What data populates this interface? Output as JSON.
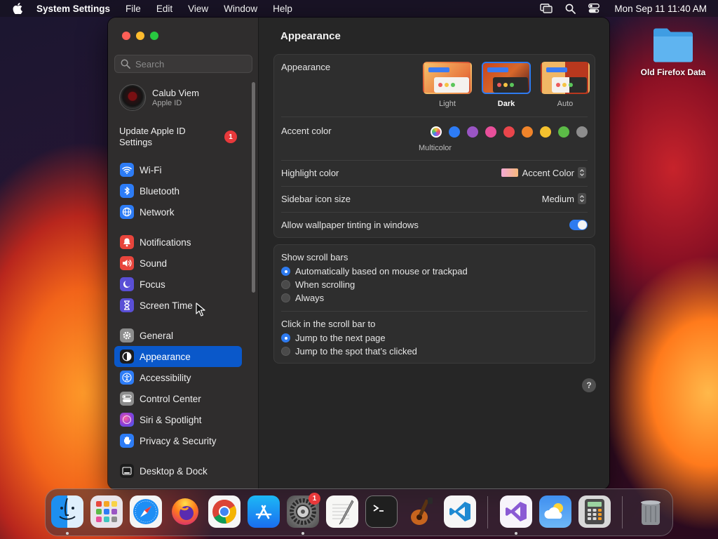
{
  "menubar": {
    "app_name": "System Settings",
    "items": [
      "File",
      "Edit",
      "View",
      "Window",
      "Help"
    ],
    "clock": "Mon Sep 11  11:40 AM",
    "icons": [
      "apple-icon",
      "screen-mirroring-icon",
      "spotlight-search-icon",
      "control-center-icon"
    ]
  },
  "sidebar": {
    "search_placeholder": "Search",
    "profile": {
      "name": "Calub Viem",
      "subtitle": "Apple ID"
    },
    "update": {
      "label": "Update Apple ID Settings",
      "badge": "1"
    },
    "items": [
      {
        "label": "Wi-Fi",
        "icon": "wifi-icon",
        "color": "#2d7cf6"
      },
      {
        "label": "Bluetooth",
        "icon": "bluetooth-icon",
        "color": "#2d7cf6"
      },
      {
        "label": "Network",
        "icon": "globe-icon",
        "color": "#2d7cf6"
      },
      {
        "label": "Notifications",
        "icon": "bell-icon",
        "color": "#e8453c"
      },
      {
        "label": "Sound",
        "icon": "speaker-icon",
        "color": "#e8453c"
      },
      {
        "label": "Focus",
        "icon": "moon-icon",
        "color": "#5a4fd6"
      },
      {
        "label": "Screen Time",
        "icon": "hourglass-icon",
        "color": "#5a4fd6"
      },
      {
        "label": "General",
        "icon": "gear-icon",
        "color": "#8c8c8c"
      },
      {
        "label": "Appearance",
        "icon": "appearance-icon",
        "color": "#1c1c1c",
        "selected": true
      },
      {
        "label": "Accessibility",
        "icon": "accessibility-icon",
        "color": "#2d7cf6"
      },
      {
        "label": "Control Center",
        "icon": "control-center-icon",
        "color": "#8c8c8c"
      },
      {
        "label": "Siri & Spotlight",
        "icon": "siri-icon",
        "color": "#b53fd1"
      },
      {
        "label": "Privacy & Security",
        "icon": "hand-icon",
        "color": "#2d7cf6"
      },
      {
        "label": "Desktop & Dock",
        "icon": "dock-icon",
        "color": "#1c1c1c"
      }
    ]
  },
  "main": {
    "title": "Appearance",
    "appearance": {
      "label": "Appearance",
      "options": [
        "Light",
        "Dark",
        "Auto"
      ],
      "selected": "Dark"
    },
    "accent": {
      "label": "Accent color",
      "caption": "Multicolor",
      "colors": [
        "multicolor",
        "#2d7cf6",
        "#9a55c4",
        "#e84f9a",
        "#e9454b",
        "#f0842a",
        "#f5c12e",
        "#5cbb47",
        "#8d8d8d"
      ]
    },
    "highlight": {
      "label": "Highlight color",
      "value": "Accent Color"
    },
    "sidebar_icon_size": {
      "label": "Sidebar icon size",
      "value": "Medium"
    },
    "wallpaper_tinting": {
      "label": "Allow wallpaper tinting in windows",
      "enabled": true
    },
    "scroll_bars": {
      "label": "Show scroll bars",
      "options": [
        "Automatically based on mouse or trackpad",
        "When scrolling",
        "Always"
      ],
      "selected": "Automatically based on mouse or trackpad"
    },
    "click_scroll": {
      "label": "Click in the scroll bar to",
      "options": [
        "Jump to the next page",
        "Jump to the spot that’s clicked"
      ],
      "selected": "Jump to the next page"
    },
    "help": "?"
  },
  "desktop": {
    "folder_label": "Old Firefox Data"
  },
  "dock": {
    "apps": [
      {
        "name": "Finder",
        "icon": "finder-icon",
        "running": true
      },
      {
        "name": "Launchpad",
        "icon": "launchpad-icon"
      },
      {
        "name": "Safari",
        "icon": "safari-icon"
      },
      {
        "name": "Firefox",
        "icon": "firefox-icon"
      },
      {
        "name": "Chrome",
        "icon": "chrome-icon"
      },
      {
        "name": "App Store",
        "icon": "app-store-icon"
      },
      {
        "name": "System Settings",
        "icon": "system-settings-icon",
        "running": true,
        "badge": "1"
      },
      {
        "name": "TextEdit",
        "icon": "textedit-icon"
      },
      {
        "name": "Terminal",
        "icon": "terminal-icon"
      },
      {
        "name": "GarageBand",
        "icon": "garageband-icon"
      },
      {
        "name": "Visual Studio Code",
        "icon": "vscode-icon"
      },
      {
        "name": "Visual Studio",
        "icon": "visual-studio-icon",
        "running": true
      },
      {
        "name": "Weather",
        "icon": "weather-icon"
      },
      {
        "name": "Calculator",
        "icon": "calculator-icon"
      },
      {
        "name": "Trash",
        "icon": "trash-icon"
      }
    ]
  }
}
